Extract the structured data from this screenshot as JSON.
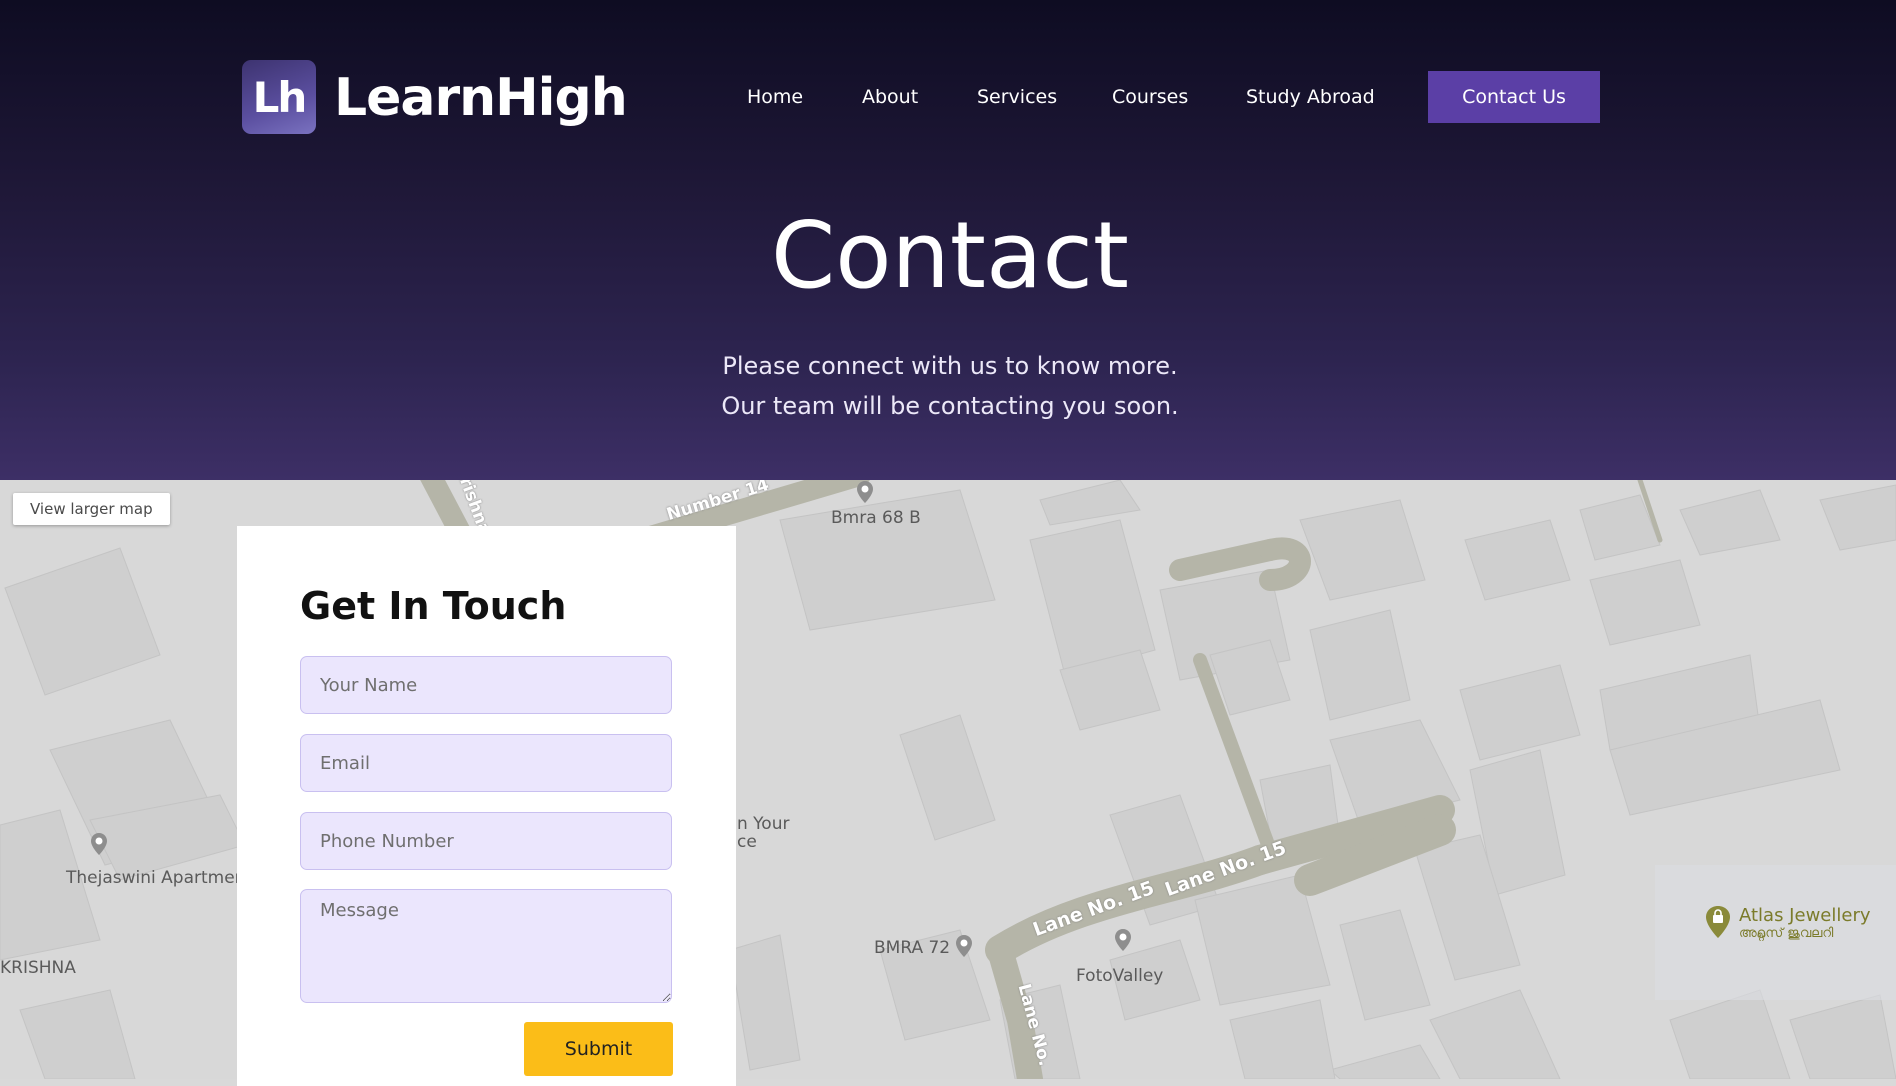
{
  "brand": {
    "logo_mark": "Lh",
    "name": "LearnHigh"
  },
  "nav": {
    "items": [
      {
        "label": "Home"
      },
      {
        "label": "About"
      },
      {
        "label": "Services"
      },
      {
        "label": "Courses"
      },
      {
        "label": "Study Abroad"
      }
    ],
    "cta_label": "Contact Us"
  },
  "hero": {
    "title": "Contact",
    "subtitle_line1": "Please connect with us to know more.",
    "subtitle_line2": "Our team will be contacting you soon."
  },
  "map": {
    "view_larger_label": "View larger map",
    "labels": {
      "street_number_14": "Number 14",
      "street_krishna": "Krishna",
      "bmra_68b": "Bmra 68 B",
      "thejaswini": "Thejaswini Apartment",
      "krishna": "KRISHNA",
      "in_your_place": "n Your",
      "in_your_place_2": "ce",
      "lane_15a": "Lane No. 15",
      "lane_15b": "Lane No. 15",
      "lane_no": "Lane No.",
      "bmra_72": "BMRA 72",
      "fotovalley": "FotoValley",
      "atlas": "Atlas Jewellery",
      "atlas_ml": "അറ്റ്ലസ് ജുവലറി"
    }
  },
  "form": {
    "title": "Get In Touch",
    "name_placeholder": "Your Name",
    "email_placeholder": "Email",
    "phone_placeholder": "Phone Number",
    "message_placeholder": "Message",
    "submit_label": "Submit"
  },
  "colors": {
    "hero_top": "#0e0c22",
    "hero_bottom": "#3d2f66",
    "cta": "#5b3fa6",
    "field_bg": "#ebe6fd",
    "submit": "#fbbd18"
  }
}
